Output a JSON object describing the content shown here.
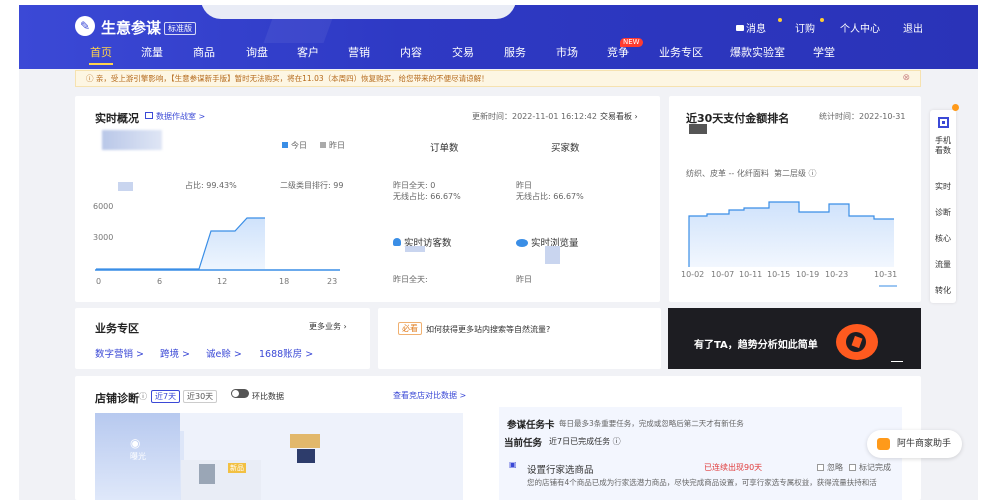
{
  "header": {
    "brand": "生意参谋",
    "edition": "标准版",
    "right": {
      "message": "消息",
      "subscribe": "订购",
      "personal": "个人中心",
      "logout": "退出"
    },
    "nav": [
      {
        "label": "首页",
        "active": true
      },
      {
        "label": "流量"
      },
      {
        "label": "商品"
      },
      {
        "label": "询盘"
      },
      {
        "label": "客户"
      },
      {
        "label": "营销"
      },
      {
        "label": "内容"
      },
      {
        "label": "交易"
      },
      {
        "label": "服务"
      },
      {
        "label": "市场"
      },
      {
        "label": "竞争"
      },
      {
        "label": "业务专区"
      },
      {
        "label": "爆款实验室"
      },
      {
        "label": "学堂"
      }
    ],
    "new_badge": "NEW"
  },
  "notice": {
    "text": "亲，受上游引擎影响，【生意参谋新手版】暂时无法购买，将在11.03（本周四）恢复购买，给您带来的不便尽请谅解！",
    "close": "⊗"
  },
  "realtime": {
    "title": "实时概况",
    "link": "数据作战室 >",
    "updated": "更新时间：2022-11-01 16:12:42",
    "trade_board": "交易看板",
    "legend_today": "今日",
    "legend_yesterday": "昨日",
    "occupy_label": "占比: 99.43%",
    "rank_label": "二级类目排行: 99",
    "order_count": "订单数",
    "buyer_count": "买家数",
    "yesterday_all_order": "昨日全天: 0",
    "wireless_order": "无线占比: 66.67%",
    "yesterday_all_buyer": "昨日",
    "wireless_buyer": "无线占比: 66.67%",
    "visitors": "实时访客数",
    "views": "实时浏览量",
    "visitors_yesterday": "昨日全天:",
    "views_yesterday": "昨日"
  },
  "chart_left": {
    "y_ticks": [
      "6000",
      "3000"
    ],
    "x_ticks": [
      "0",
      "6",
      "12",
      "18",
      "23"
    ]
  },
  "ranking": {
    "title": "近30天支付金额排名",
    "stat_time": "统计时间：2022-10-31",
    "category": "纺织、皮革 -- 化纤面料",
    "level": "第二层级"
  },
  "chart_right": {
    "x_ticks": [
      "10-02",
      "10-07",
      "10-11",
      "10-15",
      "10-19",
      "10-23",
      "10-31"
    ]
  },
  "business": {
    "title": "业务专区",
    "more": "更多业务",
    "links": [
      "数字营销 >",
      "跨境 >",
      "诚e赊 >",
      "1688账房 >"
    ]
  },
  "tips": {
    "tag": "必看",
    "question": "如何获得更多站内搜索等自然流量?"
  },
  "banner": {
    "text": "有了TA，趋势分析如此简单"
  },
  "diagnosis": {
    "title": "店铺诊断",
    "range7": "近7天",
    "range30": "近30天",
    "compare": "环比数据",
    "peer_link": "查看竞店对比数据 >",
    "new_tag": "新品",
    "visit_label": "曝光"
  },
  "tasks": {
    "title": "参谋任务卡",
    "desc": "每日最多3条重要任务，完成或忽略后第二天才有新任务",
    "current": "当前任务",
    "done": "近7日已完成任务",
    "task_title": "设置行家选商品",
    "task_status": "已连续出现90天",
    "ignore": "忽略",
    "mark_done": "标记完成",
    "task_desc": "您的店铺有4个商品已成为行家选潜力商品，尽快完成商品设置，可享行家选专属权益，获得流量扶持和活"
  },
  "sidebar": {
    "items": [
      "手机看数",
      "实时",
      "诊断",
      "核心",
      "流量",
      "转化"
    ]
  },
  "assistant": {
    "label": "阿牛商家助手"
  },
  "colors": {
    "header": "#3b49d6",
    "accent": "#ffd34d",
    "chart_line": "#3a8ee6",
    "chart_fill": "#cfe2fb"
  }
}
